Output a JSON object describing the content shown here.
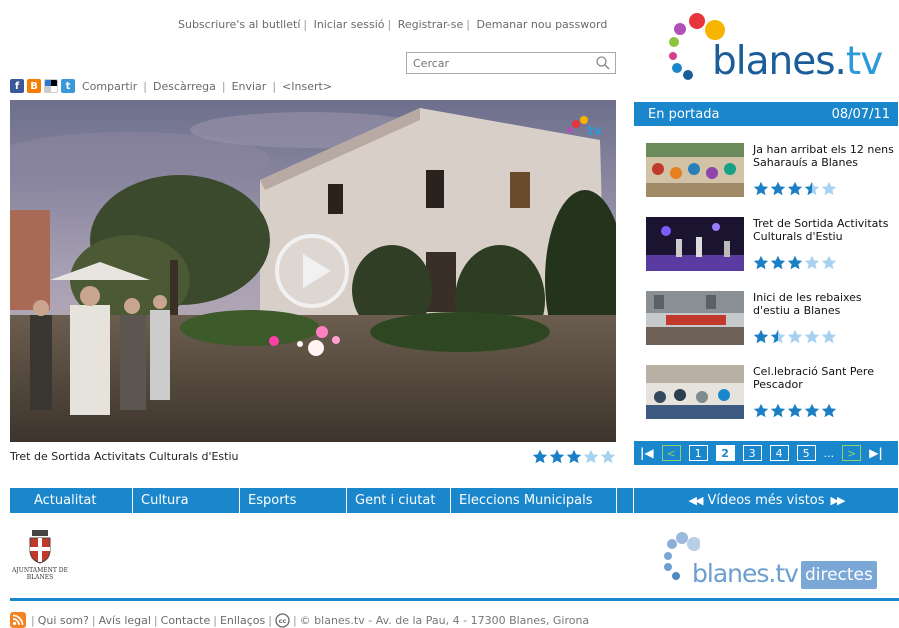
{
  "header": {
    "links": [
      "Subscriure's al butlletí",
      "Iniciar sessió",
      "Registrar-se",
      "Demanar nou password"
    ],
    "search_placeholder": "Cercar",
    "logo": {
      "brand_main": "blanes.",
      "brand_tld": "tv"
    }
  },
  "share": {
    "icons": [
      "facebook-icon",
      "blogger-icon",
      "delicious-icon",
      "twitter-icon"
    ],
    "links": [
      "Compartir",
      "Descàrrega",
      "Enviar",
      "<Insert>"
    ]
  },
  "player": {
    "title": "Tret de Sortida Activitats Culturals d'Estiu",
    "rating": 3,
    "max_rating": 5,
    "watermark": "tv"
  },
  "portada": {
    "title": "En portada",
    "date": "08/07/11",
    "items": [
      {
        "title": "Ja han arribat els 12 nens Saharauís a Blanes",
        "rating": 3.5
      },
      {
        "title": "Tret de Sortida Activitats Culturals d'Estiu",
        "rating": 3
      },
      {
        "title": "Inici de les rebaixes d'estiu a Blanes",
        "rating": 1.5
      },
      {
        "title": "Cel.lebració Sant Pere Pescador",
        "rating": 5
      }
    ],
    "pager": {
      "pages": [
        "1",
        "2",
        "3",
        "4",
        "5"
      ],
      "current": "2",
      "ellipsis": "..."
    }
  },
  "nav": {
    "items": [
      "Actualitat",
      "Cultura",
      "Esports",
      "Gent i ciutat",
      "Eleccions Municipals"
    ],
    "most_viewed": "Vídeos més vistos"
  },
  "ajuntament": {
    "line1": "AJUNTAMENT DE",
    "line2": "BLANES"
  },
  "directes": {
    "brand_main": "blanes.",
    "brand_tld": "tv",
    "label": "directes"
  },
  "footer": {
    "links": [
      "Qui som?",
      "Avís legal",
      "Contacte",
      "Enllaços"
    ],
    "copyright": "© blanes.tv - Av. de la Pau, 4 - 17300 Blanes, Girona"
  },
  "colors": {
    "accent": "#1a86cc",
    "star": "#1a7fc4",
    "star_empty": "#a8d2f0",
    "pager_arrow": "#8fd06a"
  }
}
